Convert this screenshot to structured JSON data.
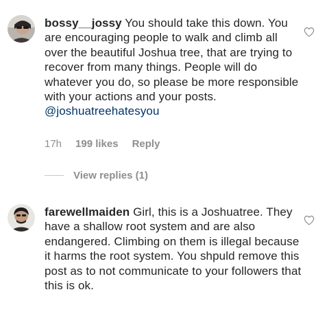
{
  "comments": [
    {
      "username": "bossy__jossy",
      "text": "You should take this down. You are encouraging people to walk and climb all over the beautiful Joshua tree, that are trying to recover from many things. People will do whatever you do, so please be more responsible with your actions and your posts.",
      "mention": "@joshuatreehatesyou",
      "time": "17h",
      "likes": "199 likes",
      "reply_label": "Reply",
      "view_replies": "View replies (1)"
    },
    {
      "username": "farewellmaiden",
      "text": "Girl, this is a Joshuatree. They have a shallow root system and are also endangered. Climbing on them is illegal because it harms the root system. You shpuld remove this post as to not communicate to your followers that this is ok."
    }
  ],
  "icons": {
    "like": "heart-outline-icon"
  },
  "colors": {
    "text": "#262626",
    "meta": "#8e8e8e",
    "mention": "#003569"
  }
}
